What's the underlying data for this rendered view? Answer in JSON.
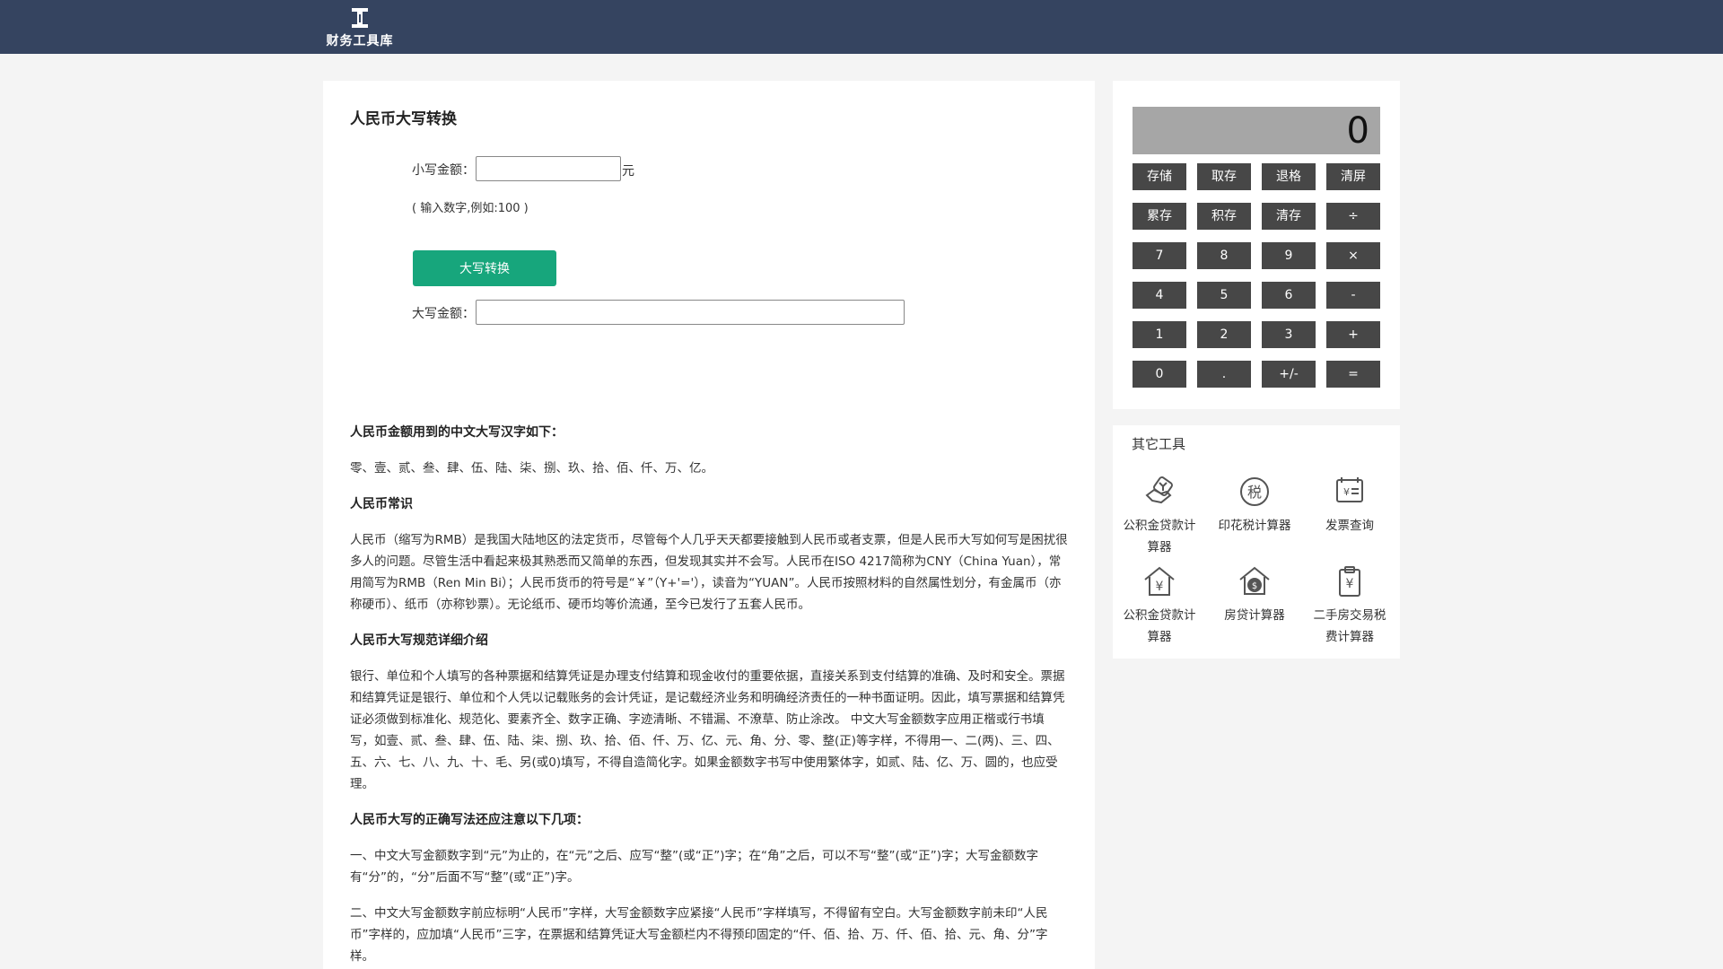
{
  "header": {
    "logo_text": "财务工具库"
  },
  "converter": {
    "title": "人民币大写转换",
    "amount_label": "小写金额：",
    "amount_value": "",
    "unit": "元",
    "hint": "( 输入数字,例如:100 )",
    "button": "大写转换",
    "result_label": "大写金额：",
    "result_value": ""
  },
  "article": {
    "h1": "人民币金额用到的中文大写汉字如下：",
    "p1": "零、壹、贰、叁、肆、伍、陆、柒、捌、玖、拾、佰、仟、万、亿。",
    "h2": "人民币常识",
    "p2": "人民币（缩写为RMB）是我国大陆地区的法定货币，尽管每个人几乎天天都要接触到人民币或者支票，但是人民币大写如何写是困扰很多人的问题。尽管生活中看起来极其熟悉而又简单的东西，但发现其实并不会写。人民币在ISO 4217简称为CNY（China Yuan），常用简写为RMB（Ren Min Bi）；人民币货币的符号是“￥”（Y+'='），读音为“YUAN”。人民币按照材料的自然属性划分，有金属币（亦称硬币）、纸币（亦称钞票）。无论纸币、硬币均等价流通，至今已发行了五套人民币。",
    "h3": "人民币大写规范详细介绍",
    "p3": "银行、单位和个人填写的各种票据和结算凭证是办理支付结算和现金收付的重要依据，直接关系到支付结算的准确、及时和安全。票据和结算凭证是银行、单位和个人凭以记载账务的会计凭证，是记载经济业务和明确经济责任的一种书面证明。因此，填写票据和结算凭证必须做到标准化、规范化、要素齐全、数字正确、字迹清晰、不错漏、不潦草、防止涂改。 中文大写金额数字应用正楷或行书填写，如壹、贰、叁、肆、伍、陆、柒、捌、玖、拾、佰、仟、万、亿、元、角、分、零、整(正)等字样，不得用一、二(两)、三、四、五、六、七、八、九、十、毛、另(或0)填写，不得自造简化字。如果金额数字书写中使用繁体字，如贰、陆、亿、万、圆的，也应受理。",
    "h4": "人民币大写的正确写法还应注意以下几项：",
    "p4": "一、中文大写金额数字到“元”为止的，在“元”之后、应写“整”(或“正”)字；在“角”之后，可以不写“整”(或“正”)字；大写金额数字有“分”的，“分”后面不写“整”(或“正”)字。",
    "p5": "二、中文大写金额数字前应标明“人民币”字样，大写金额数字应紧接“人民币”字样填写，不得留有空白。大写金额数字前未印“人民币”字样的，应加填“人民币”三字，在票据和结算凭证大写金额栏内不得预印固定的“仟、佰、拾、万、仟、佰、拾、元、角、分”字样。"
  },
  "calculator": {
    "display": "0",
    "rows": [
      [
        "存储",
        "取存",
        "退格",
        "清屏"
      ],
      [
        "累存",
        "积存",
        "清存",
        "÷"
      ],
      [
        "7",
        "8",
        "9",
        "×"
      ],
      [
        "4",
        "5",
        "6",
        "-"
      ],
      [
        "1",
        "2",
        "3",
        "+"
      ],
      [
        "0",
        ".",
        "+/-",
        "="
      ]
    ]
  },
  "other_tools": {
    "title": "其它工具",
    "items": [
      {
        "label": "公积金贷款计算器",
        "icon": "loan-hands-icon"
      },
      {
        "label": "印花税计算器",
        "icon": "tax-stamp-icon"
      },
      {
        "label": "发票查询",
        "icon": "invoice-icon"
      },
      {
        "label": "公积金贷款计算器",
        "icon": "yuan-house-icon"
      },
      {
        "label": "房贷计算器",
        "icon": "dollar-house-icon"
      },
      {
        "label": "二手房交易税费计算器",
        "icon": "yuan-clipboard-icon"
      }
    ]
  }
}
